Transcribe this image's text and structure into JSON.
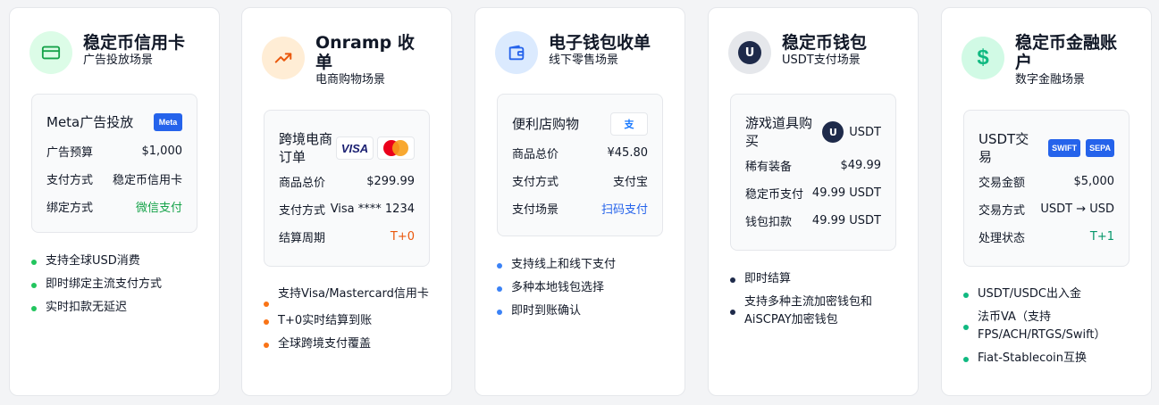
{
  "cards": [
    {
      "title": "稳定币信用卡",
      "subtitle": "广告投放场景",
      "icon": "credit-card-icon",
      "accent": "#16a34a",
      "example": {
        "title": "Meta广告投放",
        "badge": "Meta",
        "rows": [
          {
            "label": "广告预算",
            "value": "$1,000"
          },
          {
            "label": "支付方式",
            "value": "稳定币信用卡"
          },
          {
            "label": "绑定方式",
            "value": "微信支付"
          }
        ]
      },
      "bullets": [
        "支持全球USD消费",
        "即时绑定主流支付方式",
        "实时扣款无延迟"
      ]
    },
    {
      "title": "Onramp 收单",
      "subtitle": "电商购物场景",
      "icon": "trending-up-icon",
      "accent": "#ea580c",
      "example": {
        "title": "跨境电商订单",
        "badge_visa": "VISA",
        "rows": [
          {
            "label": "商品总价",
            "value": "$299.99"
          },
          {
            "label": "支付方式",
            "value": "Visa **** 1234"
          },
          {
            "label": "结算周期",
            "value": "T+0"
          }
        ]
      },
      "bullets": [
        "支持Visa/Mastercard信用卡",
        "T+0实时结算到账",
        "全球跨境支付覆盖"
      ]
    },
    {
      "title": "电子钱包收单",
      "subtitle": "线下零售场景",
      "icon": "wallet-icon",
      "accent": "#2563eb",
      "example": {
        "title": "便利店购物",
        "badge": "支",
        "rows": [
          {
            "label": "商品总价",
            "value": "¥45.80"
          },
          {
            "label": "支付方式",
            "value": "支付宝"
          },
          {
            "label": "支付场景",
            "value": "扫码支付"
          }
        ]
      },
      "bullets": [
        "支持线上和线下支付",
        "多种本地钱包选择",
        "即时到账确认"
      ]
    },
    {
      "title": "稳定币钱包",
      "subtitle": "USDT支付场景",
      "icon": "usdt-coin-icon",
      "icon_letter": "U",
      "accent": "#1e2a4a",
      "example": {
        "title": "游戏道具购买",
        "badge_letter": "U",
        "badge": "USDT",
        "rows": [
          {
            "label": "稀有装备",
            "value": "$49.99"
          },
          {
            "label": "稳定币支付",
            "value": "49.99 USDT"
          },
          {
            "label": "钱包扣款",
            "value": "49.99 USDT"
          }
        ]
      },
      "bullets": [
        "即时结算",
        "支持多种主流加密钱包和AiSCPAY加密钱包"
      ]
    },
    {
      "title": "稳定币金融账户",
      "subtitle": "数字金融场景",
      "icon": "dollar-icon",
      "icon_letter": "$",
      "accent": "#10b981",
      "example": {
        "title": "USDT交易",
        "badge1": "SWIFT",
        "badge2": "SEPA",
        "rows": [
          {
            "label": "交易金额",
            "value": "$5,000"
          },
          {
            "label": "交易方式",
            "value": "USDT → USD"
          },
          {
            "label": "处理状态",
            "value": "T+1"
          }
        ]
      },
      "bullets": [
        "USDT/USDC出入金",
        "法币VA（支持FPS/ACH/RTGS/Swift）",
        "Fiat-Stablecoin互换"
      ]
    }
  ]
}
